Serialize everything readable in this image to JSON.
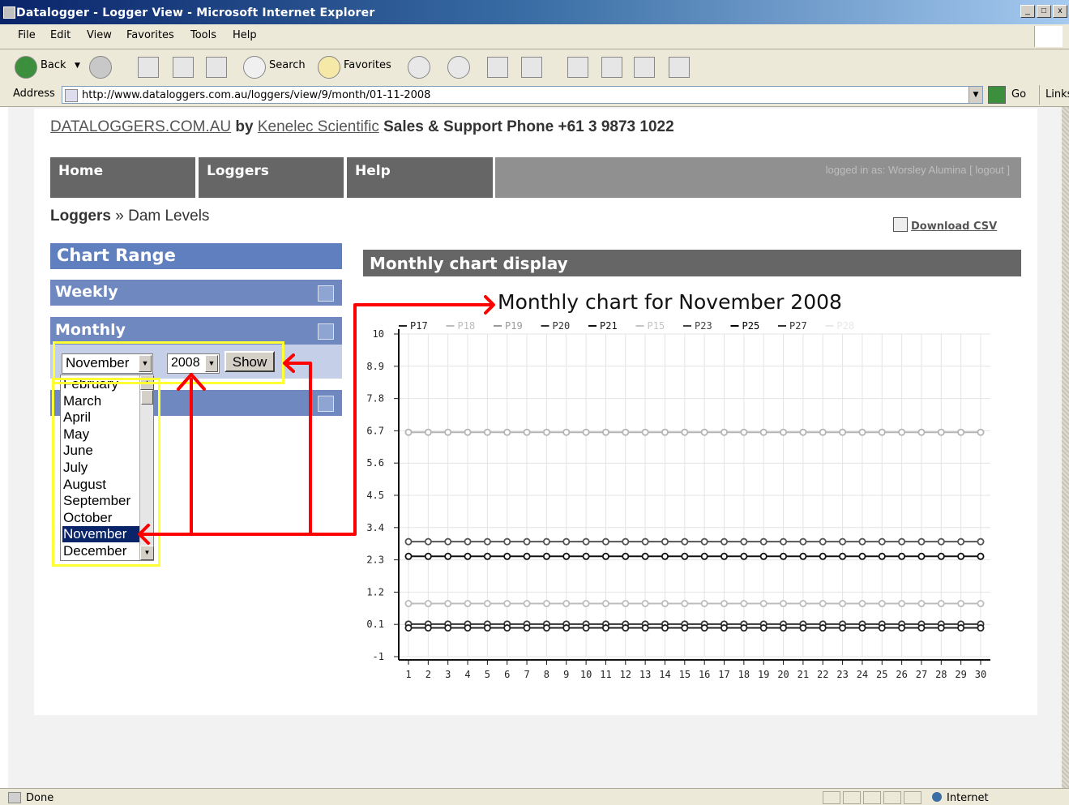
{
  "window": {
    "title": "Datalogger - Logger View - Microsoft Internet Explorer",
    "controls": [
      "_",
      "□",
      "x"
    ]
  },
  "menu": {
    "items": [
      "File",
      "Edit",
      "View",
      "Favorites",
      "Tools",
      "Help"
    ]
  },
  "toolbar": {
    "back": "Back",
    "search": "Search",
    "favorites": "Favorites"
  },
  "address": {
    "label": "Address",
    "url": "http://www.dataloggers.com.au/loggers/view/9/month/01-11-2008",
    "go": "Go",
    "links": "Links"
  },
  "site": {
    "brand": "DATALOGGERS.COM.AU",
    "by": "by",
    "company": "Kenelec Scientific",
    "support": "Sales & Support Phone  +61 3 9873 1022"
  },
  "nav": {
    "home": "Home",
    "loggers": "Loggers",
    "help": "Help",
    "user": "logged in as: Worsley Alumina  [ logout ]"
  },
  "breadcrumb": {
    "root": "Loggers",
    "sep": "»",
    "current": "Dam Levels"
  },
  "download": {
    "label": "Download CSV"
  },
  "sidebar": {
    "title": "Chart Range",
    "weekly": "Weekly",
    "monthly": "Monthly",
    "month_value": "November",
    "year_value": "2008",
    "show": "Show",
    "months": [
      "February",
      "March",
      "April",
      "May",
      "June",
      "July",
      "August",
      "September",
      "October",
      "November",
      "December"
    ],
    "selected_index": 9
  },
  "chart_panel": {
    "header": "Monthly chart display"
  },
  "chart_data": {
    "type": "line",
    "title": "Monthly chart for November 2008",
    "xlabel": "",
    "ylabel": "",
    "x": [
      1,
      2,
      3,
      4,
      5,
      6,
      7,
      8,
      9,
      10,
      11,
      12,
      13,
      14,
      15,
      16,
      17,
      18,
      19,
      20,
      21,
      22,
      23,
      24,
      25,
      26,
      27,
      28,
      29,
      30
    ],
    "ylim": [
      -1,
      10
    ],
    "yticks": [
      "10",
      "8.9",
      "7.8",
      "6.7",
      "5.6",
      "4.5",
      "3.4",
      "2.3",
      "1.2",
      "0.1",
      "-1"
    ],
    "grid": true,
    "legend_position": "top",
    "legend": [
      "P17",
      "P18",
      "P19",
      "P20",
      "P21",
      "P15",
      "P23",
      "P25",
      "P27",
      "P28"
    ],
    "series": [
      {
        "name": "P19",
        "color": "#b4b4b4",
        "value": 6.65
      },
      {
        "name": "P23",
        "color": "#555555",
        "value": 2.92
      },
      {
        "name": "P25",
        "color": "#111111",
        "value": 2.42
      },
      {
        "name": "P18",
        "color": "#bdbdbd",
        "value": 0.81
      },
      {
        "name": "P20",
        "color": "#333333",
        "value": 0.11
      },
      {
        "name": "P17",
        "color": "#222222",
        "value": -0.02
      }
    ],
    "legend_colors": [
      "#222222",
      "#bdbdbd",
      "#9a9a9a",
      "#333333",
      "#111111",
      "#c4c4c4",
      "#444444",
      "#000000",
      "#333333",
      "#e8e8e8"
    ]
  },
  "status": {
    "left": "Done",
    "zone": "Internet"
  }
}
